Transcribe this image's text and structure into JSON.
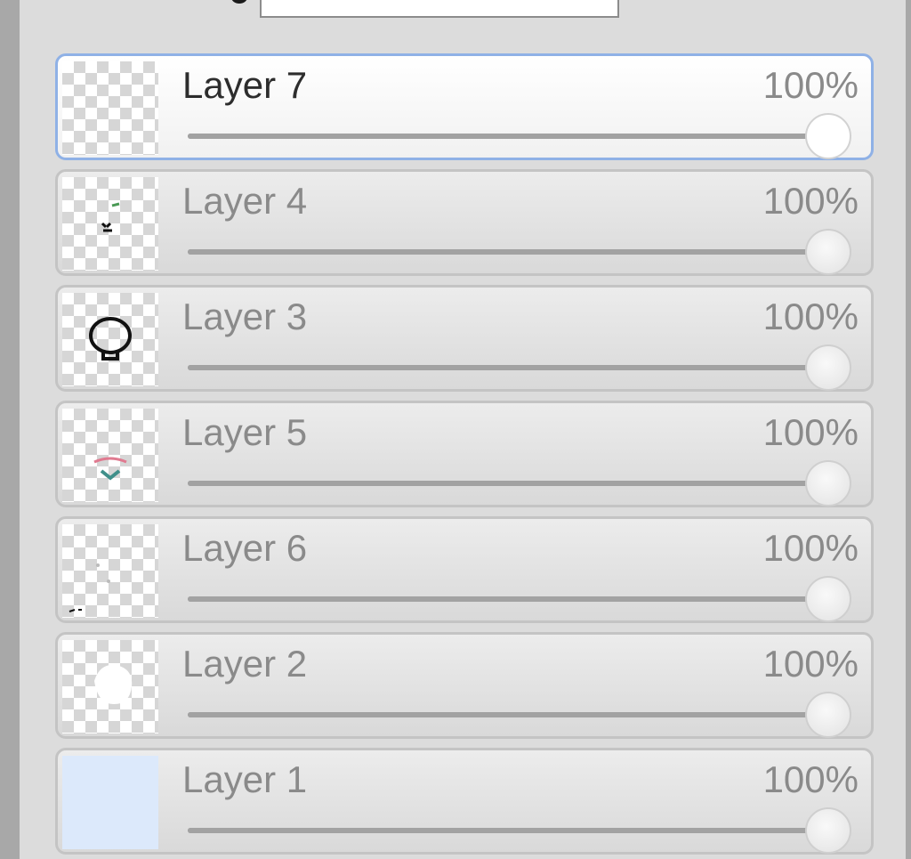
{
  "panel": {
    "name_field_value": "",
    "layers": [
      {
        "name": "Layer 7",
        "opacity_label": "100%",
        "opacity": 1.0,
        "selected": true,
        "thumb": "empty"
      },
      {
        "name": "Layer 4",
        "opacity_label": "100%",
        "opacity": 1.0,
        "selected": false,
        "thumb": "marks"
      },
      {
        "name": "Layer 3",
        "opacity_label": "100%",
        "opacity": 1.0,
        "selected": false,
        "thumb": "head"
      },
      {
        "name": "Layer 5",
        "opacity_label": "100%",
        "opacity": 1.0,
        "selected": false,
        "thumb": "face"
      },
      {
        "name": "Layer 6",
        "opacity_label": "100%",
        "opacity": 1.0,
        "selected": false,
        "thumb": "specks"
      },
      {
        "name": "Layer 2",
        "opacity_label": "100%",
        "opacity": 1.0,
        "selected": false,
        "thumb": "white-blob"
      },
      {
        "name": "Layer 1",
        "opacity_label": "100%",
        "opacity": 1.0,
        "selected": false,
        "thumb": "solid"
      }
    ]
  },
  "colors": {
    "selection_border": "#8fb1e6",
    "layer1_fill": "#dce9fb"
  }
}
